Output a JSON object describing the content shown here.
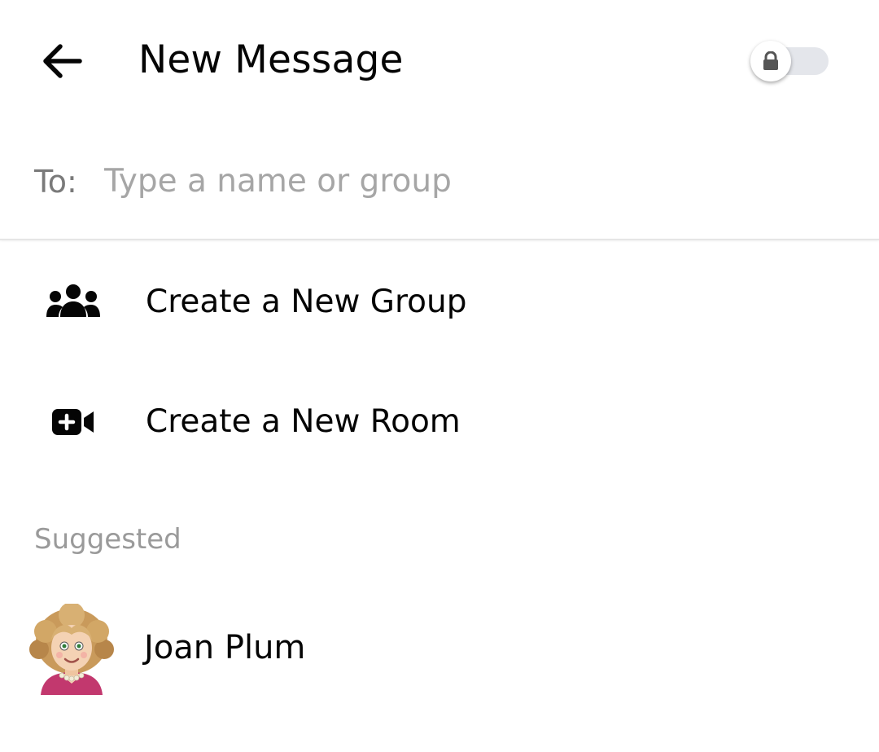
{
  "header": {
    "title": "New Message",
    "back_icon": "arrow-left-icon",
    "toggle_icon": "lock-icon",
    "toggle_on": false
  },
  "to_field": {
    "label": "To:",
    "value": "",
    "placeholder": "Type a name or group"
  },
  "actions": [
    {
      "label": "Create a New Group",
      "icon": "group-icon"
    },
    {
      "label": "Create a New Room",
      "icon": "video-add-icon"
    }
  ],
  "suggested": {
    "section_label": "Suggested",
    "contacts": [
      {
        "name": "Joan Plum",
        "avatar": "avatar-cartoon-woman"
      }
    ]
  },
  "colors": {
    "text_primary": "#050505",
    "text_secondary": "#7a7a7a",
    "placeholder": "#a6a6a6",
    "toggle_track": "#e4e6eb",
    "divider": "#e6e6e6"
  }
}
